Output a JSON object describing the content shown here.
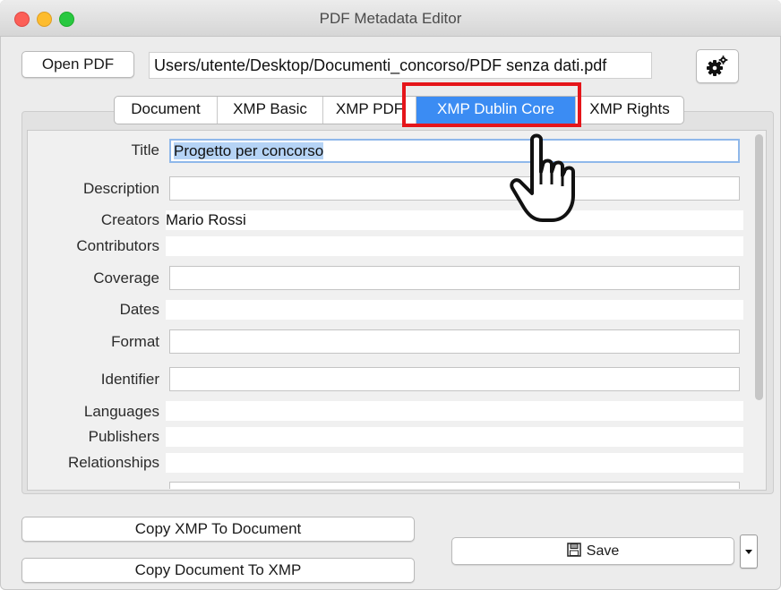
{
  "window": {
    "title": "PDF Metadata Editor"
  },
  "toolbar": {
    "open_label": "Open PDF",
    "file_path": "Users/utente/Desktop/Documenti_concorso/PDF senza dati.pdf",
    "settings_icon": "gear-icon"
  },
  "tabs": [
    {
      "label": "Document",
      "active": false
    },
    {
      "label": "XMP Basic",
      "active": false
    },
    {
      "label": "XMP PDF",
      "active": false
    },
    {
      "label": "XMP Dublin Core",
      "active": true
    },
    {
      "label": "XMP Rights",
      "active": false
    }
  ],
  "fields": {
    "title": {
      "label": "Title",
      "value": "Progetto per concorso"
    },
    "description": {
      "label": "Description",
      "value": ""
    },
    "creators": {
      "label": "Creators",
      "value": "Mario Rossi"
    },
    "contributors": {
      "label": "Contributors",
      "value": ""
    },
    "coverage": {
      "label": "Coverage",
      "value": ""
    },
    "dates": {
      "label": "Dates",
      "value": ""
    },
    "format": {
      "label": "Format",
      "value": ""
    },
    "identifier": {
      "label": "Identifier",
      "value": ""
    },
    "languages": {
      "label": "Languages",
      "value": ""
    },
    "publishers": {
      "label": "Publishers",
      "value": ""
    },
    "relationships": {
      "label": "Relationships",
      "value": ""
    }
  },
  "bottom": {
    "copy_xmp_label": "Copy XMP To Document",
    "copy_doc_label": "Copy Document To XMP",
    "save_label": "Save",
    "save_icon": "floppy-disk-icon",
    "dropdown_icon": "chevron-down-icon"
  },
  "colors": {
    "accent": "#3b8cf3",
    "highlight_box": "#e5151a"
  }
}
